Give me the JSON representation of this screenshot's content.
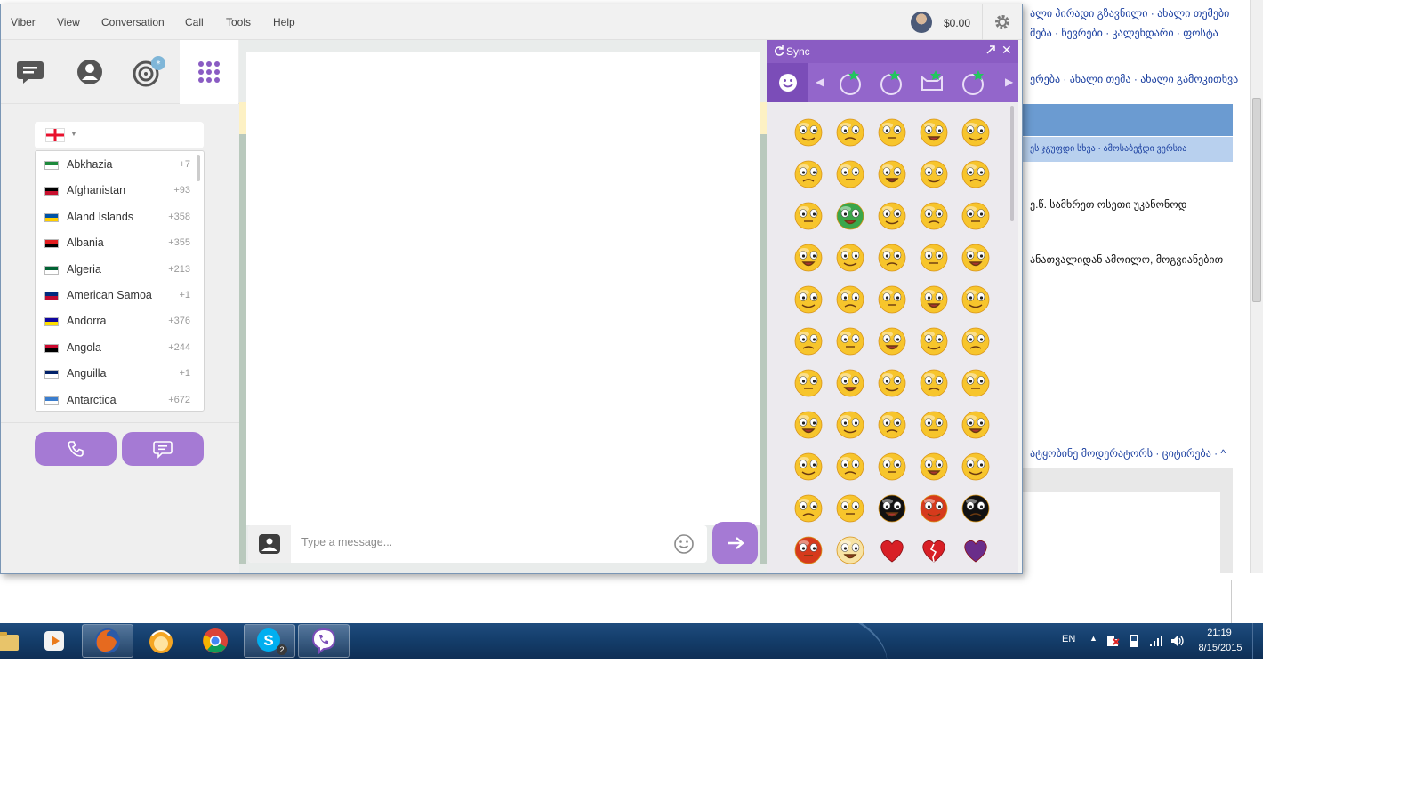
{
  "menu": {
    "items": [
      "Viber",
      "View",
      "Conversation",
      "Call",
      "Tools",
      "Help"
    ],
    "balance": "$0.00"
  },
  "nav": {
    "tabs": [
      "chats-icon",
      "contacts-icon",
      "public-chats-icon",
      "keypad-icon"
    ],
    "country_list": [
      {
        "name": "Abkhazia",
        "code": "+7",
        "flag": [
          "#1e8a3c",
          "#ffffff"
        ]
      },
      {
        "name": "Afghanistan",
        "code": "+93",
        "flag": [
          "#000000",
          "#c8102e"
        ]
      },
      {
        "name": "Aland Islands",
        "code": "+358",
        "flag": [
          "#0053a5",
          "#ffce00"
        ]
      },
      {
        "name": "Albania",
        "code": "+355",
        "flag": [
          "#e41e20",
          "#000000"
        ]
      },
      {
        "name": "Algeria",
        "code": "+213",
        "flag": [
          "#006233",
          "#ffffff"
        ]
      },
      {
        "name": "American Samoa",
        "code": "+1",
        "flag": [
          "#002b7f",
          "#bf0a30"
        ]
      },
      {
        "name": "Andorra",
        "code": "+376",
        "flag": [
          "#10069f",
          "#fedf00"
        ]
      },
      {
        "name": "Angola",
        "code": "+244",
        "flag": [
          "#cc092f",
          "#000000"
        ]
      },
      {
        "name": "Anguilla",
        "code": "+1",
        "flag": [
          "#012169",
          "#ffffff"
        ]
      },
      {
        "name": "Antarctica",
        "code": "+672",
        "flag": [
          "#3a7dce",
          "#ffffff"
        ]
      }
    ]
  },
  "chat": {
    "placeholder": "Type a message..."
  },
  "emoji_panel": {
    "title": "Sync",
    "accent": "#8a5cc3",
    "rows": [
      [
        "smile",
        "unhappy",
        "wink",
        "angry",
        "in-love"
      ],
      [
        "tongue",
        "laugh",
        "shocked",
        "kiss",
        "happy"
      ],
      [
        "yawn",
        "sick",
        "worried",
        "grin",
        "tongue-out"
      ],
      [
        "money",
        "doubtful",
        "flirty",
        "surprised",
        "sad"
      ],
      [
        "sleepy",
        "crazy",
        "nerd",
        "smirk",
        "cool"
      ],
      [
        "scared",
        "crying",
        "love-kiss",
        "drool",
        "grimace"
      ],
      [
        "dizzy",
        "dead",
        "blank",
        "relieved",
        "annoyed"
      ],
      [
        "thinking",
        "shy",
        "cheeky",
        "bored",
        "exhausted"
      ],
      [
        "mad",
        "frown",
        "amazed",
        "singing",
        "silly"
      ],
      [
        "innocent",
        "smug",
        "ninja",
        "furious",
        "devil-cat"
      ],
      [
        "devil",
        "angel",
        "heart",
        "broken-heart",
        "purple-heart"
      ]
    ]
  },
  "background_page": {
    "lines": [
      "ალი პირადი გზავნილი · ახალი თემები",
      "მება · წევრები · კალენდარი · ფოსტა",
      "ერება · ახალი თემა · ახალი გამოკითხვა",
      "ეს ჯგუფდი სხვა · ამოსაბეჭდი ვერსია",
      "ე.წ. სამხრეთ ოსეთი უკანონოდ",
      "ანათვალიდან ამოილო, მოგვიანებით",
      "ატყობინე მოდერატორს · ციტირება · ^"
    ]
  },
  "taskbar": {
    "apps": [
      "explorer-icon",
      "media-player-icon",
      "firefox-icon",
      "hola-icon",
      "chrome-icon",
      "skype-icon",
      "viber-icon"
    ],
    "skype_badge": "2",
    "language": "EN",
    "time": "21:19",
    "date": "8/15/2015"
  }
}
